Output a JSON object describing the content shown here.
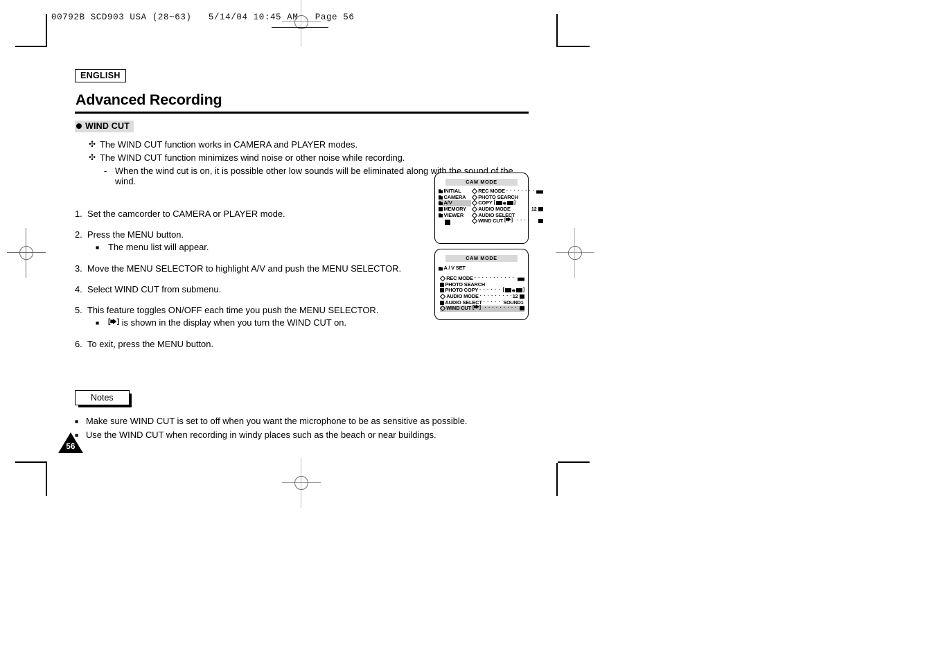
{
  "slug": {
    "text": "00792B SCD903 USA (28~63)   5/14/04 10:45 AM   Page 56"
  },
  "header": {
    "language_badge": "ENGLISH",
    "title": "Advanced Recording",
    "section": "WIND CUT"
  },
  "intro": {
    "bullets": [
      {
        "marker": "✣",
        "text": "The WIND CUT function works in CAMERA and PLAYER modes."
      },
      {
        "marker": "✣",
        "text": "The WIND CUT function minimizes wind noise or other noise while recording."
      }
    ],
    "sub": {
      "marker": "-",
      "text": "When the wind cut is on, it is possible other low sounds will be eliminated along with the sound of the wind."
    }
  },
  "steps": [
    {
      "num": "1.",
      "text": "Set the camcorder to CAMERA  or PLAYER mode."
    },
    {
      "num": "2.",
      "text": "Press the MENU button.",
      "sub": [
        {
          "marker": "■",
          "text": "The menu list will appear."
        }
      ]
    },
    {
      "num": "3.",
      "text": "Move the MENU SELECTOR to highlight A/V and push the MENU SELECTOR."
    },
    {
      "num": "4.",
      "text": "Select WIND CUT from submenu."
    },
    {
      "num": "5.",
      "text": "This feature toggles ON/OFF each time you push the MENU SELECTOR.",
      "sub": [
        {
          "marker": "■",
          "icon": "wind-cut-icon",
          "text": "is shown in the display when you turn the WIND CUT on."
        }
      ]
    },
    {
      "num": "6.",
      "text": "To exit, press the MENU button."
    }
  ],
  "notes": {
    "badge": "Notes",
    "items": [
      {
        "marker": "■",
        "text": "Make sure WIND CUT is set to off when you want the microphone to be as sensitive as possible."
      },
      {
        "marker": "■",
        "text": "Use the WIND CUT when recording in windy places such as the beach or near buildings."
      }
    ]
  },
  "page_number": "56",
  "lcd1": {
    "title": "CAM  MODE",
    "left_items": [
      {
        "label": "INITIAL",
        "icon": "folder-icon",
        "selected": false
      },
      {
        "label": "CAMERA",
        "icon": "folder-icon",
        "selected": false
      },
      {
        "label": "A/V",
        "icon": "folder-icon",
        "selected": true
      },
      {
        "label": "MEMORY",
        "icon": "square-icon",
        "selected": false
      },
      {
        "label": "VIEWER",
        "icon": "folder-icon",
        "selected": false
      }
    ],
    "rows": [
      {
        "label": "REC MODE",
        "icon": "diamond-icon",
        "dots": true,
        "value_icon": "tape-icon",
        "value": ""
      },
      {
        "label": "PHOTO SEARCH",
        "icon": "diamond-icon",
        "dots": false,
        "value": ""
      },
      {
        "label": "COPY",
        "icon": "diamond-icon",
        "dots": false,
        "value": "",
        "copy_glyph": true
      },
      {
        "label": "AUDIO MODE",
        "icon": "diamond-icon",
        "dots": true,
        "value": "12",
        "value_icon": "card-icon"
      },
      {
        "label": "AUDIO SELECT",
        "icon": "diamond-icon",
        "dots": false,
        "value": ""
      },
      {
        "label": "WIND CUT",
        "icon": "diamond-icon",
        "dots": true,
        "value": "",
        "value_icon": "tape-icon",
        "wind_glyph": true
      }
    ]
  },
  "lcd2": {
    "title": "CAM  MODE",
    "heading": {
      "label": "A / V SET",
      "icon": "folder-icon"
    },
    "rows": [
      {
        "label": "REC MODE",
        "icon": "diamond-outline-icon",
        "dots": true,
        "value": "",
        "value_icon": "tape-icon"
      },
      {
        "label": "PHOTO SEARCH",
        "icon": "folder-icon",
        "dots": false,
        "value": ""
      },
      {
        "label": "PHOTO COPY",
        "icon": "folder-icon",
        "dots": true,
        "value": "",
        "copy_glyph": true
      },
      {
        "label": "AUDIO MODE",
        "icon": "diamond-outline-icon",
        "dots": true,
        "value": "12",
        "value_icon": "card-icon"
      },
      {
        "label": "AUDIO SELECT",
        "icon": "folder-icon",
        "dots": true,
        "value": "SOUND1"
      },
      {
        "label": "WIND CUT",
        "icon": "diamond-outline-icon",
        "dots": true,
        "value": "",
        "value_icon": "card-icon",
        "wind_glyph": true,
        "selected": true
      }
    ]
  }
}
